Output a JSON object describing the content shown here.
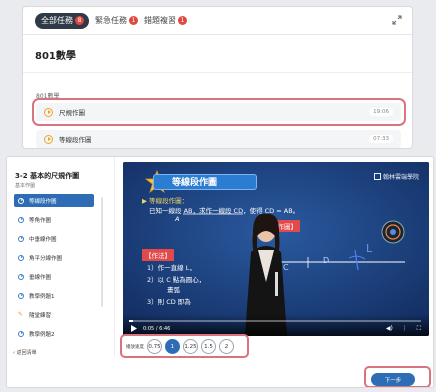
{
  "tabs": [
    {
      "label": "全部任務",
      "badge": "8",
      "active": true
    },
    {
      "label": "緊急任務",
      "badge": "1",
      "active": false
    },
    {
      "label": "錯題複習",
      "badge": "1",
      "active": false
    }
  ],
  "course": {
    "title": "801數學",
    "group_label": "801數學",
    "lessons": [
      {
        "name": "尺規作圖",
        "time": "19:06"
      },
      {
        "name": "等線段作圖",
        "time": "07:33"
      }
    ]
  },
  "sidebar": {
    "title": "3-2 基本的尺規作圖",
    "subtitle": "基本作圖",
    "items": [
      {
        "label": "等線段作圖",
        "kind": "video",
        "active": true
      },
      {
        "label": "等角作圖",
        "kind": "video",
        "active": false
      },
      {
        "label": "中垂線作圖",
        "kind": "video",
        "active": false
      },
      {
        "label": "角平分線作圖",
        "kind": "video",
        "active": false
      },
      {
        "label": "垂線作圖",
        "kind": "video",
        "active": false
      },
      {
        "label": "教學例題1",
        "kind": "video",
        "active": false
      },
      {
        "label": "隨堂練習",
        "kind": "practice",
        "active": false
      },
      {
        "label": "教學例題2",
        "kind": "video",
        "active": false
      }
    ],
    "back_label": "返回清單"
  },
  "video": {
    "banner": "等線段作圖",
    "brand": "翰林雲端學院",
    "heading": "▶ 等線段作圖：",
    "line1": "已知一線段 AB，求作一線段 CD，使得 CD = AB。",
    "point_a": "A",
    "diagram_tag": "【作圖】",
    "method_tag": "【作法】",
    "step1": "1）作一直線 L，",
    "step2": "2）以 C 點為圓心，",
    "step2b": "畫弧",
    "step3": "3）則 CD 即為",
    "label_c": "C",
    "label_d": "D",
    "label_l": "L",
    "time_text": "0:05 / 6:46",
    "progress": 0.012
  },
  "speed": {
    "label": "播放速度",
    "options": [
      "0.75",
      "1",
      "1.25",
      "1.5",
      "2"
    ],
    "selected": "1"
  },
  "next_label": "下一步",
  "colors": {
    "accent": "#2e6db5",
    "highlight": "#d9737e",
    "badge": "#e0483e",
    "play": "#f0a428"
  }
}
